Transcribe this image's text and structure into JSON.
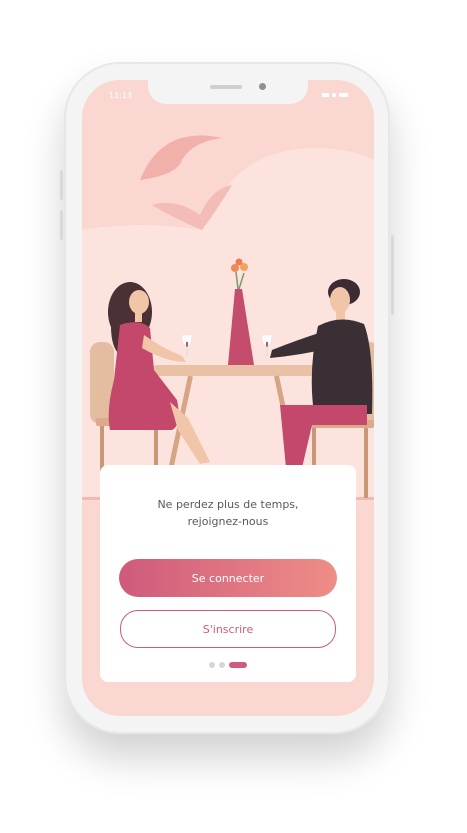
{
  "status_bar": {
    "time": "11:13"
  },
  "onboarding": {
    "tagline_line1": "Ne perdez plus de temps,",
    "tagline_line2": "rejoignez-nous",
    "primary_button": "Se connecter",
    "secondary_button": "S'inscrire",
    "pagination": {
      "total": 3,
      "active_index": 3
    }
  },
  "colors": {
    "accent": "#cf5a7c",
    "accent_gradient_end": "#ee8e87",
    "screen_background": "#fbd7d1"
  }
}
